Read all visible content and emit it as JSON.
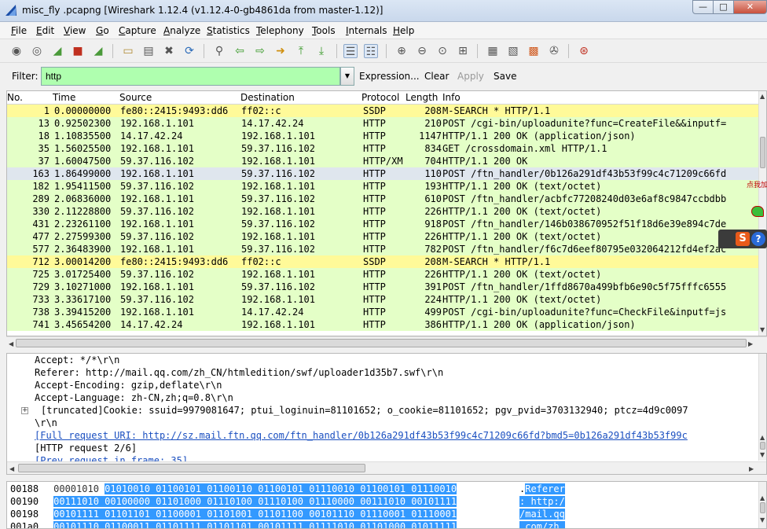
{
  "window": {
    "title": "misc_fly .pcapng   [Wireshark 1.12.4  (v1.12.4-0-gb4861da from master-1.12)]",
    "min_glyph": "—",
    "max_glyph": "□",
    "close_glyph": "✕"
  },
  "menu": [
    "File",
    "Edit",
    "View",
    "Go",
    "Capture",
    "Analyze",
    "Statistics",
    "Telephony",
    "Tools",
    "Internals",
    "Help"
  ],
  "toolbar_icons": [
    "interface-list-icon",
    "capture-options-icon",
    "start-capture-icon",
    "stop-capture-icon",
    "restart-capture-icon",
    "open-file-icon",
    "save-file-icon",
    "close-file-icon",
    "reload-icon",
    "find-packet-icon",
    "go-back-icon",
    "go-forward-icon",
    "go-to-packet-icon",
    "go-first-icon",
    "go-last-icon",
    "colorize-icon",
    "auto-scroll-icon",
    "zoom-in-icon",
    "zoom-out-icon",
    "normal-size-icon",
    "resize-columns-icon",
    "capture-filters-icon",
    "display-filters-icon",
    "coloring-rules-icon",
    "preferences-icon",
    "help-icon"
  ],
  "filter": {
    "label": "Filter:",
    "value": "http",
    "expression": "Expression...",
    "clear": "Clear",
    "apply": "Apply",
    "save": "Save"
  },
  "packet_list": {
    "columns": [
      "No.",
      "Time",
      "Source",
      "Destination",
      "Protocol",
      "Length",
      "Info"
    ],
    "rows": [
      {
        "no": "1",
        "time": "0.00000000",
        "src": "fe80::2415:9493:dd6",
        "dst": "ff02::c",
        "proto": "SSDP",
        "len": "208",
        "info": "M-SEARCH * HTTP/1.1",
        "kind": "ssdp"
      },
      {
        "no": "13",
        "time": "0.92502300",
        "src": "192.168.1.101",
        "dst": "14.17.42.24",
        "proto": "HTTP",
        "len": "210",
        "info": "POST /cgi-bin/uploadunite?func=CreateFile&&inputf=",
        "kind": "http"
      },
      {
        "no": "18",
        "time": "1.10835500",
        "src": "14.17.42.24",
        "dst": "192.168.1.101",
        "proto": "HTTP",
        "len": "1147",
        "info": "HTTP/1.1 200 OK  (application/json)",
        "kind": "http"
      },
      {
        "no": "35",
        "time": "1.56025500",
        "src": "192.168.1.101",
        "dst": "59.37.116.102",
        "proto": "HTTP",
        "len": "834",
        "info": "GET /crossdomain.xml HTTP/1.1",
        "kind": "http"
      },
      {
        "no": "37",
        "time": "1.60047500",
        "src": "59.37.116.102",
        "dst": "192.168.1.101",
        "proto": "HTTP/XM",
        "len": "704",
        "info": "HTTP/1.1 200 OK",
        "kind": "http"
      },
      {
        "no": "163",
        "time": "1.86499000",
        "src": "192.168.1.101",
        "dst": "59.37.116.102",
        "proto": "HTTP",
        "len": "110",
        "info": "POST /ftn_handler/0b126a291df43b53f99c4c71209c66fd",
        "kind": "sel"
      },
      {
        "no": "182",
        "time": "1.95411500",
        "src": "59.37.116.102",
        "dst": "192.168.1.101",
        "proto": "HTTP",
        "len": "193",
        "info": "HTTP/1.1 200 OK  (text/octet)",
        "kind": "http"
      },
      {
        "no": "289",
        "time": "2.06836000",
        "src": "192.168.1.101",
        "dst": "59.37.116.102",
        "proto": "HTTP",
        "len": "610",
        "info": "POST /ftn_handler/acbfc77208240d03e6af8c9847ccbdbb",
        "kind": "http"
      },
      {
        "no": "330",
        "time": "2.11228800",
        "src": "59.37.116.102",
        "dst": "192.168.1.101",
        "proto": "HTTP",
        "len": "226",
        "info": "HTTP/1.1 200 OK  (text/octet)",
        "kind": "http"
      },
      {
        "no": "431",
        "time": "2.23261100",
        "src": "192.168.1.101",
        "dst": "59.37.116.102",
        "proto": "HTTP",
        "len": "918",
        "info": "POST /ftn_handler/146b038670952f51f18d6e39e894c7de",
        "kind": "http"
      },
      {
        "no": "477",
        "time": "2.27599300",
        "src": "59.37.116.102",
        "dst": "192.168.1.101",
        "proto": "HTTP",
        "len": "226",
        "info": "HTTP/1.1 200 OK  (text/octet)",
        "kind": "http"
      },
      {
        "no": "577",
        "time": "2.36483900",
        "src": "192.168.1.101",
        "dst": "59.37.116.102",
        "proto": "HTTP",
        "len": "782",
        "info": "POST /ftn_handler/f6c7d6eef80795e032064212fd4ef2ac",
        "kind": "http"
      },
      {
        "no": "712",
        "time": "3.00014200",
        "src": "fe80::2415:9493:dd6",
        "dst": "ff02::c",
        "proto": "SSDP",
        "len": "208",
        "info": "M-SEARCH * HTTP/1.1",
        "kind": "ssdp"
      },
      {
        "no": "725",
        "time": "3.01725400",
        "src": "59.37.116.102",
        "dst": "192.168.1.101",
        "proto": "HTTP",
        "len": "226",
        "info": "HTTP/1.1 200 OK  (text/octet)",
        "kind": "http"
      },
      {
        "no": "729",
        "time": "3.10271000",
        "src": "192.168.1.101",
        "dst": "59.37.116.102",
        "proto": "HTTP",
        "len": "391",
        "info": "POST /ftn_handler/1ffd8670a499bfb6e90c5f75fffc6555",
        "kind": "http"
      },
      {
        "no": "733",
        "time": "3.33617100",
        "src": "59.37.116.102",
        "dst": "192.168.1.101",
        "proto": "HTTP",
        "len": "224",
        "info": "HTTP/1.1 200 OK  (text/octet)",
        "kind": "http"
      },
      {
        "no": "738",
        "time": "3.39415200",
        "src": "192.168.1.101",
        "dst": "14.17.42.24",
        "proto": "HTTP",
        "len": "499",
        "info": "POST /cgi-bin/uploadunite?func=CheckFile&inputf=js",
        "kind": "http"
      },
      {
        "no": "741",
        "time": "3.45654200",
        "src": "14.17.42.24",
        "dst": "192.168.1.101",
        "proto": "HTTP",
        "len": "386",
        "info": "HTTP/1.1 200 OK  (application/json)",
        "kind": "http"
      }
    ]
  },
  "side_widget": {
    "label": "点我加"
  },
  "details": {
    "lines": [
      "Accept: */*\\r\\n",
      "Referer: http://mail.qq.com/zh_CN/htmledition/swf/uploader1d35b7.swf\\r\\n",
      "Accept-Encoding: gzip,deflate\\r\\n",
      "Accept-Language: zh-CN,zh;q=0.8\\r\\n",
      "[truncated]Cookie: ssuid=9979081647; ptui_loginuin=81101652; o_cookie=81101652; pgv_pvid=3703132940; ptcz=4d9c0097",
      "\\r\\n",
      "[Full request URI: http://sz.mail.ftn.qq.com/ftn_handler/0b126a291df43b53f99c4c71209c66fd?bmd5=0b126a291df43b53f99c",
      "[HTTP request 2/6]",
      "[Prev request in frame: 35]"
    ],
    "expander_glyph": "+"
  },
  "bytes": {
    "rows": [
      {
        "off": "00188",
        "plain": "00001010 ",
        "hl": "01010010 01100101 01100110 01100101 01110010 01100101 01110010",
        "ascii_plain": ".",
        "ascii_hl": "Referer"
      },
      {
        "off": "00190",
        "plain": "",
        "hl": "00111010 00100000 01101000 01110100 01110100 01110000 00111010 00101111",
        "ascii_plain": "",
        "ascii_hl": ": http:/"
      },
      {
        "off": "00198",
        "plain": "",
        "hl": "00101111 01101101 01100001 01101001 01101100 00101110 01110001 01110001",
        "ascii_plain": "",
        "ascii_hl": "/mail.qq"
      },
      {
        "off": "001a0",
        "plain": "",
        "hl": "00101110 01100011 01101111 01101101 00101111 01111010 01101000 01011111",
        "ascii_plain": "",
        "ascii_hl": ".com/zh_"
      }
    ]
  },
  "colors": {
    "http_row": "#e4ffc7",
    "ssdp_row": "#fffa99",
    "filter_bg": "#afffaf",
    "link": "#1a4fc0",
    "bytes_highlight": "#3399ff"
  }
}
